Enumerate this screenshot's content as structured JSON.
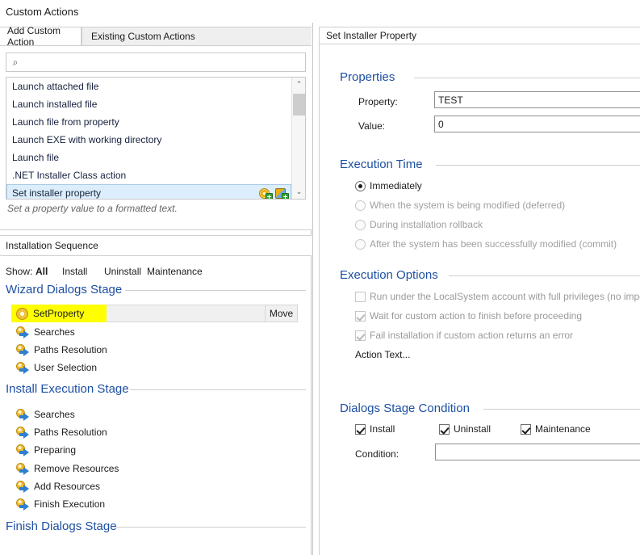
{
  "page": {
    "title": "Custom Actions"
  },
  "tabs": [
    {
      "label": "Add Custom Action",
      "active": true
    },
    {
      "label": "Existing Custom Actions",
      "active": false
    }
  ],
  "search": {
    "value": "",
    "placeholder": "",
    "icon": "search-icon"
  },
  "action_list": {
    "items": [
      {
        "label": "Launch attached file",
        "selected": false
      },
      {
        "label": "Launch installed file",
        "selected": false
      },
      {
        "label": "Launch file from property",
        "selected": false
      },
      {
        "label": "Launch EXE with working directory",
        "selected": false
      },
      {
        "label": "Launch file",
        "selected": false
      },
      {
        "label": ".NET Installer Class action",
        "selected": false
      },
      {
        "label": "Set installer property",
        "selected": true
      }
    ],
    "row_icons": [
      "add-gear-icon",
      "add-wand-icon"
    ],
    "scroll_up_glyph": "⌃",
    "scroll_down_glyph": "⌄"
  },
  "hint": "Set a property value to a formatted text.",
  "sequence": {
    "header": "Installation Sequence",
    "show_label": "Show:",
    "filters": [
      {
        "label": "All",
        "selected": true
      },
      {
        "label": "Install",
        "selected": false
      },
      {
        "label": "Uninstall",
        "selected": false
      },
      {
        "label": "Maintenance",
        "selected": false
      }
    ],
    "stages": [
      {
        "name": "Wizard Dialogs Stage",
        "items": [
          {
            "label": "SetProperty",
            "icon": "gear-icon",
            "highlighted": true,
            "move_label": "Move"
          },
          {
            "label": "Searches",
            "icon": "action-arrow-icon",
            "highlighted": false
          },
          {
            "label": "Paths Resolution",
            "icon": "action-arrow-icon",
            "highlighted": false
          },
          {
            "label": "User Selection",
            "icon": "action-arrow-icon",
            "highlighted": false
          }
        ]
      },
      {
        "name": "Install Execution Stage",
        "items": [
          {
            "label": "Searches",
            "icon": "action-arrow-icon",
            "highlighted": false
          },
          {
            "label": "Paths Resolution",
            "icon": "action-arrow-icon",
            "highlighted": false
          },
          {
            "label": "Preparing",
            "icon": "action-arrow-icon",
            "highlighted": false
          },
          {
            "label": "Remove Resources",
            "icon": "action-arrow-icon",
            "highlighted": false
          },
          {
            "label": "Add Resources",
            "icon": "action-arrow-icon",
            "highlighted": false
          },
          {
            "label": "Finish Execution",
            "icon": "action-arrow-icon",
            "highlighted": false
          }
        ]
      },
      {
        "name": "Finish Dialogs Stage",
        "items": []
      }
    ]
  },
  "detail": {
    "title": "Set Installer Property",
    "properties": {
      "group_title": "Properties",
      "property_label": "Property:",
      "property_value": "TEST",
      "value_label": "Value:",
      "value_value": "0"
    },
    "execution_time": {
      "group_title": "Execution Time",
      "options": [
        {
          "label": "Immediately",
          "checked": true,
          "enabled": true
        },
        {
          "label": "When the system is being modified (deferred)",
          "checked": false,
          "enabled": false
        },
        {
          "label": "During installation rollback",
          "checked": false,
          "enabled": false
        },
        {
          "label": "After the system has been successfully modified (commit)",
          "checked": false,
          "enabled": false
        }
      ]
    },
    "execution_options": {
      "group_title": "Execution Options",
      "options": [
        {
          "label": "Run under the LocalSystem account with full privileges (no impersonation)",
          "checked": false,
          "enabled": false
        },
        {
          "label": "Wait for custom action to finish before proceeding",
          "checked": true,
          "enabled": false
        },
        {
          "label": "Fail installation if custom action returns an error",
          "checked": true,
          "enabled": false
        }
      ],
      "action_text_link": "Action Text..."
    },
    "dialogs_stage_condition": {
      "group_title": "Dialogs Stage Condition",
      "checks": [
        {
          "label": "Install",
          "checked": true
        },
        {
          "label": "Uninstall",
          "checked": true
        },
        {
          "label": "Maintenance",
          "checked": true
        }
      ],
      "condition_label": "Condition:",
      "condition_value": ""
    }
  },
  "colors": {
    "group_heading": "#1d4fa3",
    "highlight": "#ffff00",
    "selection": "#dceefb",
    "border": "#cfcfcf"
  }
}
